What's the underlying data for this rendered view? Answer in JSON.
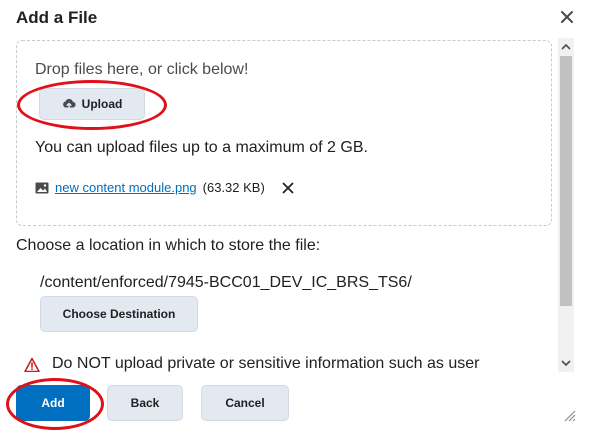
{
  "dialog": {
    "title": "Add a File"
  },
  "dropzone": {
    "drop_text": "Drop files here, or click below!",
    "upload_label": "Upload",
    "limit_text": "You can upload files up to a maximum of 2 GB.",
    "file": {
      "name": "new content module.png",
      "size": "(63.32 KB)"
    }
  },
  "location": {
    "label": "Choose a location in which to store the file:",
    "path": "/content/enforced/7945-BCC01_DEV_IC_BRS_TS6/",
    "choose_label": "Choose Destination"
  },
  "warning": {
    "text": "Do NOT upload private or sensitive information such as user"
  },
  "footer": {
    "add_label": "Add",
    "back_label": "Back",
    "cancel_label": "Cancel"
  },
  "icons": {
    "close": "close-icon",
    "upload": "cloud-upload-icon",
    "image": "image-icon",
    "remove": "remove-icon",
    "warning": "warning-icon"
  },
  "colors": {
    "primary": "#006fbf",
    "secondary_button": "#e3e9f1",
    "annotation": "#e0101a",
    "warning": "#cd2026"
  }
}
